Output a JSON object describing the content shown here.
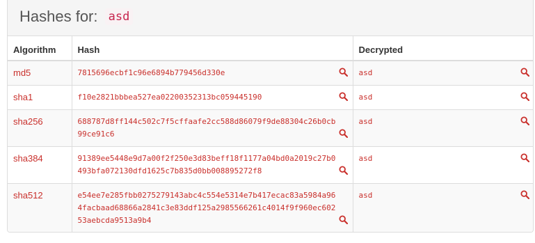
{
  "heading": {
    "prefix": "Hashes for:",
    "query": "asd"
  },
  "columns": {
    "algorithm": "Algorithm",
    "hash": "Hash",
    "decrypted": "Decrypted"
  },
  "rows": [
    {
      "algorithm": "md5",
      "hash": "7815696ecbf1c96e6894b779456d330e",
      "decrypted": "asd"
    },
    {
      "algorithm": "sha1",
      "hash": "f10e2821bbbea527ea02200352313bc059445190",
      "decrypted": "asd"
    },
    {
      "algorithm": "sha256",
      "hash": "688787d8ff144c502c7f5cffaafe2cc588d86079f9de88304c26b0cb99ce91c6",
      "decrypted": "asd"
    },
    {
      "algorithm": "sha384",
      "hash": "91389ee5448e9d7a00f2f250e3d83beff18f1177a04bd0a2019c27b0493bfa072130dfd1625c7b835d0bb008895272f8",
      "decrypted": "asd"
    },
    {
      "algorithm": "sha512",
      "hash": "e54ee7e285fbb0275279143abc4c554e5314e7b417ecac83a5984a964facbaad68866a2841c3e83ddf125a2985566261c4014f9f960ec60253aebcda9513a9b4",
      "decrypted": "asd"
    }
  ],
  "colors": {
    "link": "#c9302c",
    "code_text": "#c7254e",
    "code_bg": "#f9f2f4",
    "icon": "#c9302c"
  },
  "icons": {
    "search": "search-icon"
  }
}
